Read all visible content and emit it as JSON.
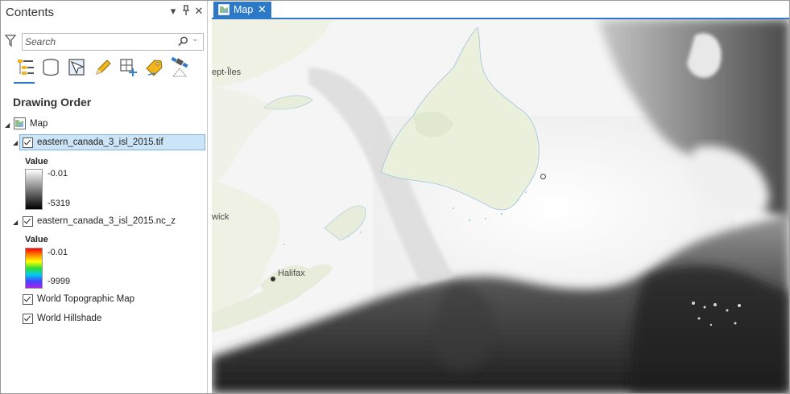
{
  "contents": {
    "title": "Contents",
    "search": {
      "placeholder": "Search",
      "value": ""
    },
    "section_heading": "Drawing Order",
    "tree": {
      "root": {
        "label": "Map"
      },
      "layers": [
        {
          "label": "eastern_canada_3_isl_2015.tif",
          "checked": true,
          "selected": true,
          "legend": {
            "title": "Value",
            "max": "-0.01",
            "min": "-5319",
            "ramp": "black-to-white"
          }
        },
        {
          "label": "eastern_canada_3_isl_2015.nc_z",
          "checked": true,
          "legend": {
            "title": "Value",
            "max": "-0.01",
            "min": "-9999",
            "ramp": "rainbow"
          }
        },
        {
          "label": "World Topographic Map",
          "checked": true
        },
        {
          "label": "World Hillshade",
          "checked": true
        }
      ]
    },
    "toolbar_icons": [
      "list-by-drawing-order-icon",
      "list-by-source-icon",
      "list-by-selection-icon",
      "list-by-editing-icon",
      "list-by-snapping-icon",
      "list-by-labeling-icon",
      "list-by-perspective-imagery-icon"
    ]
  },
  "map": {
    "tab_label": "Map",
    "place_labels": [
      "ept-Îles",
      "wick",
      "Halifax"
    ],
    "accent_color": "#2c7ac7"
  }
}
